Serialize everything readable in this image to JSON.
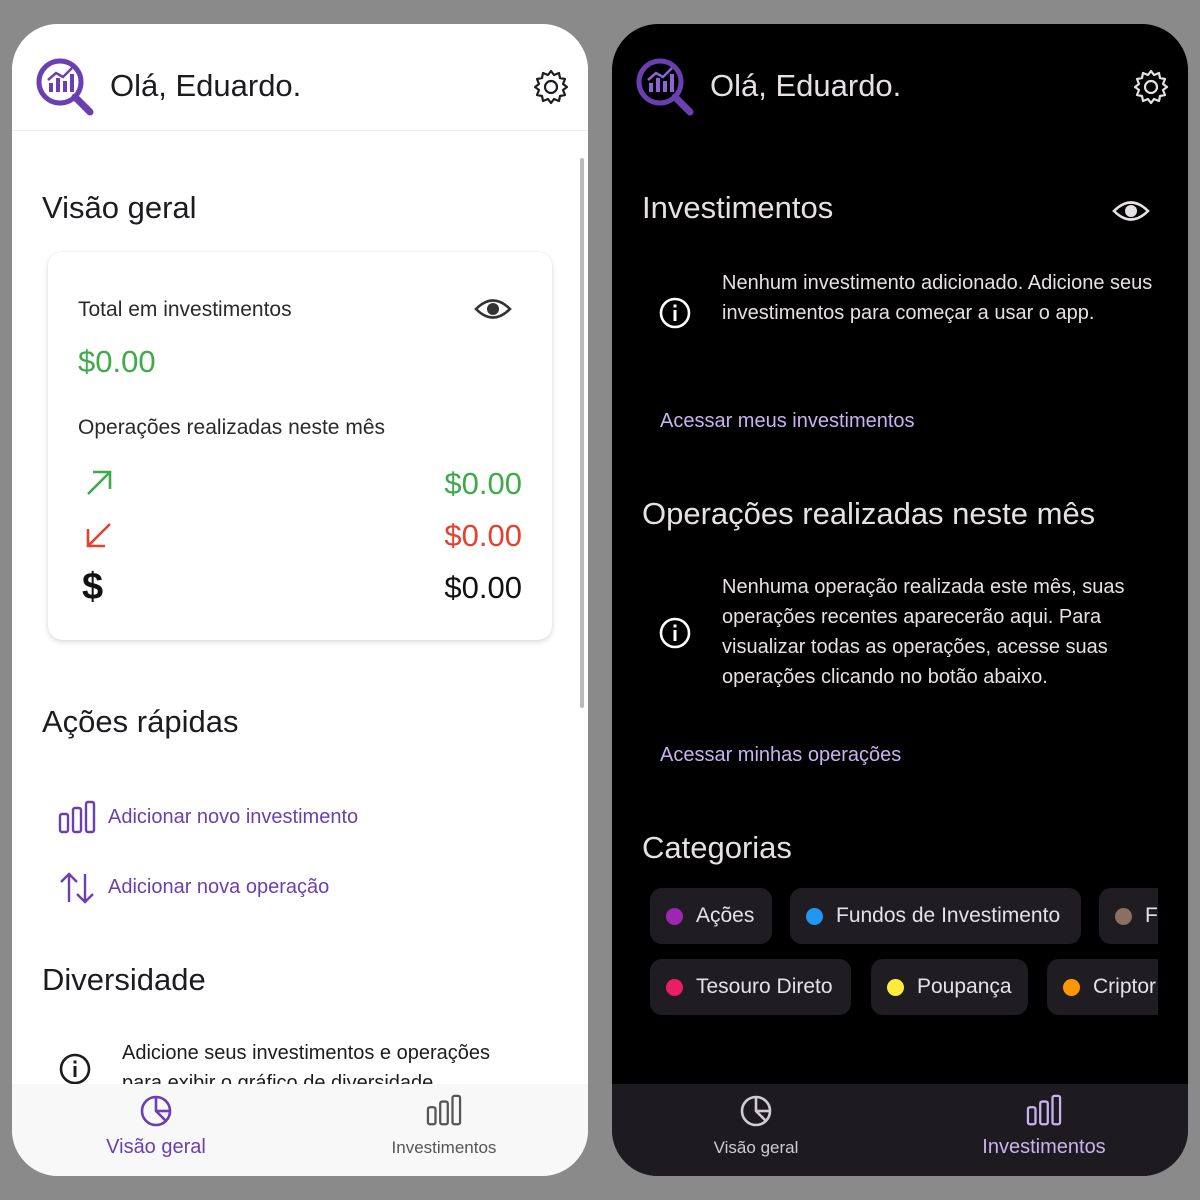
{
  "light": {
    "greeting": "Olá, Eduardo.",
    "overview_title": "Visão geral",
    "card": {
      "total_label": "Total em investimentos",
      "total_value": "$0.00",
      "ops_label": "Operações realizadas neste mês",
      "rows": [
        {
          "icon": "arrow-up-right-icon",
          "value": "$0.00",
          "color": "#3faa4a"
        },
        {
          "icon": "arrow-down-left-icon",
          "value": "$0.00",
          "color": "#e5412d"
        },
        {
          "icon": "dollar-icon",
          "value": "$0.00",
          "color": "#111111"
        }
      ]
    },
    "quick_actions_title": "Ações rápidas",
    "quick_actions": [
      {
        "icon": "bar-chart-icon",
        "label": "Adicionar novo investimento"
      },
      {
        "icon": "swap-vertical-icon",
        "label": "Adicionar nova operação"
      }
    ],
    "diversity_title": "Diversidade",
    "diversity_info": "Adicione seus investimentos e operações para exibir o gráfico de diversidade.",
    "nav": [
      {
        "icon": "pie-chart-icon",
        "label": "Visão geral",
        "active": true
      },
      {
        "icon": "bar-chart-icon",
        "label": "Investimentos",
        "active": false
      }
    ]
  },
  "dark": {
    "greeting": "Olá, Eduardo.",
    "investments_title": "Investimentos",
    "investments_info": "Nenhum investimento adicionado. Adicione seus investimentos para começar a usar o app.",
    "investments_link": "Acessar meus investimentos",
    "operations_title": "Operações realizadas neste mês",
    "operations_info": "Nenhuma operação realizada este mês, suas operações recentes aparecerão aqui. Para visualizar todas as operações, acesse suas operações clicando no botão abaixo.",
    "operations_link": "Acessar minhas operações",
    "categories_title": "Categorias",
    "categories_row1": [
      {
        "label": "Ações",
        "color": "#9c27b0"
      },
      {
        "label": "Fundos de Investimento",
        "color": "#2196f3"
      },
      {
        "label": "F",
        "color": "#8d6e63"
      }
    ],
    "categories_row2": [
      {
        "label": "Tesouro Direto",
        "color": "#e91e63"
      },
      {
        "label": "Poupança",
        "color": "#ffeb3b"
      },
      {
        "label": "Criptor",
        "color": "#ff9800"
      }
    ],
    "nav": [
      {
        "icon": "pie-chart-icon",
        "label": "Visão geral",
        "active": false
      },
      {
        "icon": "bar-chart-icon",
        "label": "Investimentos",
        "active": true
      }
    ]
  },
  "colors": {
    "accent": "#6a3fb2",
    "accent_dark": "#c9b2f0",
    "positive": "#3faa4a",
    "negative": "#e5412d"
  }
}
